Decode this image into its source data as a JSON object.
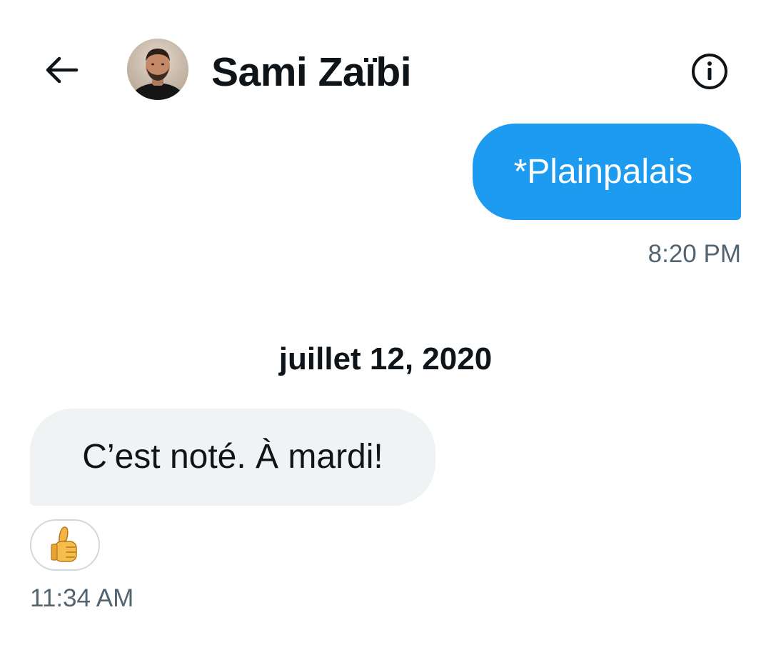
{
  "header": {
    "contact_name": "Sami Zaïbi",
    "back_icon": "arrow-left-icon",
    "info_icon": "info-circle-icon",
    "avatar": "profile-photo"
  },
  "messages": [
    {
      "direction": "sent",
      "text": "*Plainpalais",
      "time": "8:20 PM"
    },
    {
      "direction": "received",
      "text": "C’est noté. À mardi!",
      "reaction": "thumbs-up-icon",
      "time": "11:34 AM"
    }
  ],
  "date_separator": "juillet 12, 2020",
  "colors": {
    "sent_bubble": "#1d9bf0",
    "received_bubble": "#eff3f4",
    "timestamp": "#536471",
    "text": "#0f1419"
  }
}
